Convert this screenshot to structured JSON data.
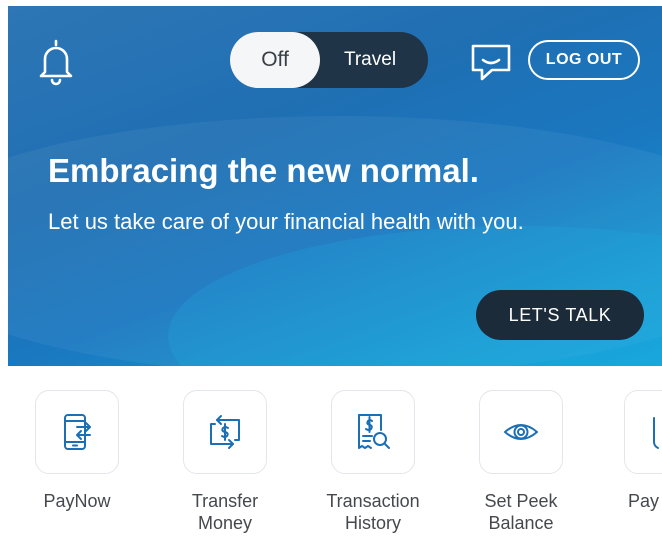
{
  "header": {
    "toggle": {
      "off_label": "Off",
      "on_label": "Travel"
    },
    "logout_label": "LOG OUT"
  },
  "banner": {
    "headline": "Embracing the new normal.",
    "subline": "Let us take care of your financial health with you.",
    "cta_label": "LET'S TALK"
  },
  "shortcuts": [
    {
      "line1": "PayNow",
      "line2": "",
      "icon": "phone-transfer-icon"
    },
    {
      "line1": "Transfer",
      "line2": "Money",
      "icon": "transfer-money-icon"
    },
    {
      "line1": "Transaction",
      "line2": "History",
      "icon": "receipt-search-icon"
    },
    {
      "line1": "Set Peek",
      "line2": "Balance",
      "icon": "eye-icon"
    },
    {
      "line1": "Pay",
      "line2": "",
      "icon": "partial-icon"
    }
  ],
  "colors": {
    "accent": "#1f6fb3",
    "icon_blue": "#1b6fb5",
    "dark_button": "#1b2b3a",
    "text_gray": "#45494e"
  }
}
